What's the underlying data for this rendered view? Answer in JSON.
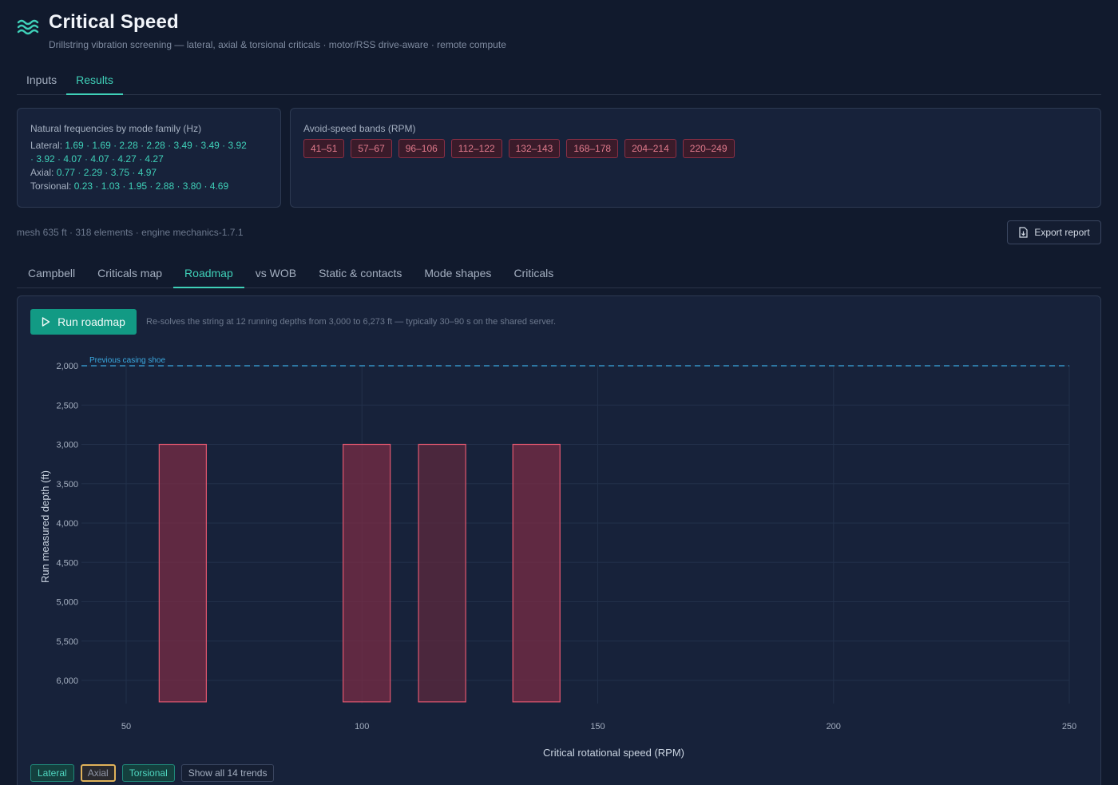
{
  "app": {
    "title": "Critical Speed",
    "subtitle": "Drillstring vibration screening — lateral, axial & torsional criticals · motor/RSS drive-aware · remote compute",
    "logo_icon": "waves-icon"
  },
  "top_tabs": [
    {
      "label": "Inputs",
      "active": false
    },
    {
      "label": "Results",
      "active": true
    }
  ],
  "frequencies": {
    "title": "Natural frequencies by mode family (Hz)",
    "lateral_label": "Lateral:",
    "lateral_values_1": "1.69 · 1.69 · 2.28 · 2.28 · 3.49 · 3.49 · 3.92",
    "lateral_values_2": "· 3.92 · 4.07 · 4.07 · 4.27 · 4.27",
    "axial_label": "Axial:",
    "axial_values": "0.77 · 2.29 · 3.75 · 4.97",
    "torsional_label": "Torsional:",
    "torsional_values": "0.23 · 1.03 · 1.95 · 2.88 · 3.80 · 4.69"
  },
  "avoid_bands": {
    "title": "Avoid-speed bands (RPM)",
    "items": [
      "41–51",
      "57–67",
      "96–106",
      "112–122",
      "132–143",
      "168–178",
      "204–214",
      "220–249"
    ]
  },
  "meta_text": "mesh 635 ft · 318 elements · engine mechanics-1.7.1",
  "export": {
    "label": "Export report",
    "icon": "file-export-icon"
  },
  "result_tabs": [
    {
      "label": "Campbell",
      "active": false
    },
    {
      "label": "Criticals map",
      "active": false
    },
    {
      "label": "Roadmap",
      "active": true
    },
    {
      "label": "vs WOB",
      "active": false
    },
    {
      "label": "Static & contacts",
      "active": false
    },
    {
      "label": "Mode shapes",
      "active": false
    },
    {
      "label": "Criticals",
      "active": false
    }
  ],
  "roadmap": {
    "run_label": "Run roadmap",
    "hint": "Re-solves the string at 12 running depths from 3,000 to 6,273 ft — typically 30–90 s on the shared server."
  },
  "chart_data": {
    "type": "bar",
    "orientation": "vertical-bands",
    "xlabel": "Critical rotational speed (RPM)",
    "ylabel": "Run measured depth (ft)",
    "xlim": [
      40,
      250
    ],
    "ylim": [
      2000,
      6300
    ],
    "y_inverted": true,
    "x_ticks": [
      50,
      100,
      150,
      200,
      250
    ],
    "y_ticks": [
      2000,
      2500,
      3000,
      3500,
      4000,
      4500,
      5000,
      5500,
      6000
    ],
    "y_tick_labels": [
      "2,000",
      "2,500",
      "3,000",
      "3,500",
      "4,000",
      "4,500",
      "5,000",
      "5,500",
      "6,000"
    ],
    "grid": true,
    "reference_line": {
      "depth": 2000,
      "label": "Previous casing shoe",
      "color": "#3ba9e0"
    },
    "bands": [
      {
        "x_min": 57,
        "x_max": 67,
        "depth_top": 3000,
        "depth_bottom": 6273,
        "color": "#7a2c45"
      },
      {
        "x_min": 96,
        "x_max": 106,
        "depth_top": 3000,
        "depth_bottom": 6273,
        "color": "#7a2c45"
      },
      {
        "x_min": 112,
        "x_max": 122,
        "depth_top": 3000,
        "depth_bottom": 6273,
        "color": "#5e2a3f"
      },
      {
        "x_min": 132,
        "x_max": 142,
        "depth_top": 3000,
        "depth_bottom": 6273,
        "color": "#7a2c45"
      }
    ]
  },
  "filters": [
    {
      "label": "Lateral",
      "style": "teal"
    },
    {
      "label": "Axial",
      "style": "axial"
    },
    {
      "label": "Torsional",
      "style": "teal"
    },
    {
      "label": "Show all 14 trends",
      "style": "plain"
    }
  ]
}
